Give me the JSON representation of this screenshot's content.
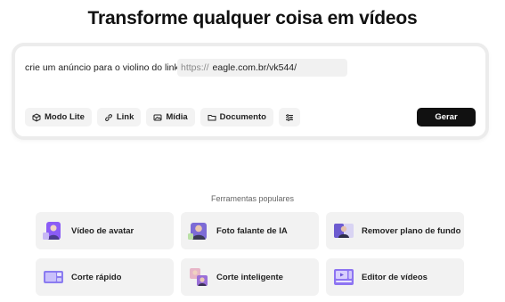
{
  "header": {
    "title": "Transforme qualquer coisa em vídeos"
  },
  "prompt": {
    "text": "crie um anúncio para o violino do link",
    "link_prefix": "https://",
    "link_value": "eagle.com.br/vk544/"
  },
  "toolbar": {
    "items": [
      {
        "label": "Modo Lite",
        "icon": "cube-icon"
      },
      {
        "label": "Link",
        "icon": "link-icon"
      },
      {
        "label": "Mídia",
        "icon": "image-icon"
      },
      {
        "label": "Documento",
        "icon": "folder-icon"
      },
      {
        "label": "",
        "icon": "sliders-icon"
      }
    ],
    "generate_label": "Gerar"
  },
  "popular_tools": {
    "section_label": "Ferramentas populares",
    "items": [
      {
        "label": "Vídeo de avatar",
        "icon": "avatar-thumbnail",
        "accent": "#8b5cf6"
      },
      {
        "label": "Foto falante de IA",
        "icon": "talking-photo-thumbnail",
        "accent": "#7c6bd6"
      },
      {
        "label": "Remover plano de fundo",
        "icon": "remove-background-thumbnail",
        "accent": "#6d5bd0"
      },
      {
        "label": "Corte rápido",
        "icon": "quick-cut-thumbnail",
        "accent": "#8b7cf0"
      },
      {
        "label": "Corte inteligente",
        "icon": "smart-cut-thumbnail",
        "accent": "#9a6fd8"
      },
      {
        "label": "Editor de vídeos",
        "icon": "video-editor-thumbnail",
        "accent": "#8d74f2"
      }
    ]
  },
  "colors": {
    "primary_button": "#111111",
    "card_background": "#f2f2f2",
    "accent_purple": "#8b5cf6"
  }
}
